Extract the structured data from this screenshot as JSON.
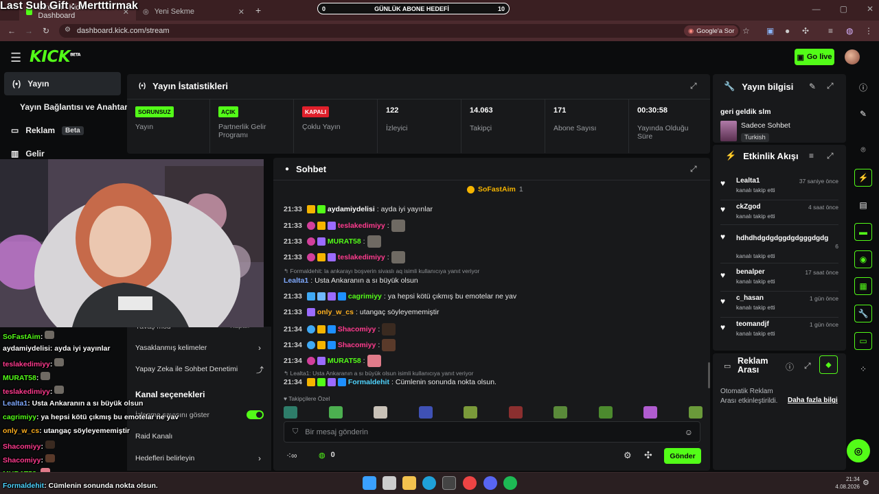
{
  "browser": {
    "tabs": [
      {
        "label": "Stream - Kick Dashboard"
      },
      {
        "label": "Yeni Sekme"
      }
    ],
    "new_tab": "+",
    "url": "dashboard.kick.com/stream",
    "ask_google": "Google'a Sor"
  },
  "overlay": {
    "last_sub": "Last Sub Gift : Mertttirmak",
    "goal_label": "GÜNLÜK ABONE HEDEFİ",
    "goal_current": "0",
    "goal_target": "10"
  },
  "header": {
    "logo": "KICK",
    "logo_tag": "BETA",
    "go_live": "Go live"
  },
  "sidebar": {
    "items": [
      {
        "label": "Yayın"
      },
      {
        "label": "Yayın Bağlantısı ve Anahtarı"
      },
      {
        "label": "Reklam",
        "badge": "Beta"
      },
      {
        "label": "Gelir"
      }
    ]
  },
  "stats": {
    "title": "Yayın İstatistikleri",
    "cells": [
      {
        "badge": "SORUNSUZ",
        "label": "Yayın"
      },
      {
        "badge": "AÇIK",
        "label": "Partnerlik Gelir Programı"
      },
      {
        "badge": "KAPALI",
        "label": "Çoklu Yayın"
      },
      {
        "value": "122",
        "label": "İzleyici"
      },
      {
        "value": "14.063",
        "label": "Takipçi"
      },
      {
        "value": "171",
        "label": "Abone Sayısı"
      },
      {
        "value": "00:30:58",
        "label": "Yayında Olduğu Süre"
      }
    ]
  },
  "info": {
    "title": "Yayın bilgisi",
    "stream_title": "geri geldik slm",
    "category": "Sadece Sohbet",
    "language": "Turkish"
  },
  "events": {
    "title": "Etkinlik Akışı",
    "items": [
      {
        "name": "Lealta1",
        "action": "kanalı takip etti",
        "time": "37 saniye önce"
      },
      {
        "name": "ckZgod",
        "action": "kanalı takip etti",
        "time": "4 saat önce"
      },
      {
        "name": "hdhdhdgdgdggdgdgggdgdg",
        "action": "kanalı takip etti",
        "time": "6"
      },
      {
        "name": "benalper",
        "action": "kanalı takip etti",
        "time": "17 saat önce"
      },
      {
        "name": "c_hasan",
        "action": "kanalı takip etti",
        "time": "1 gün önce"
      },
      {
        "name": "teomandjf",
        "action": "kanalı takip etti",
        "time": "1 gün önce"
      }
    ]
  },
  "ads": {
    "title": "Reklam Arası",
    "text": "Otomatik Reklam Arası etkinleştirildi.",
    "link": "Daha fazla bilgi"
  },
  "chat": {
    "title": "Sohbet",
    "pinned_user": "SoFastAim",
    "pinned_count": "1",
    "messages": [
      {
        "time": "21:33",
        "user": "aydamiydelisi",
        "text": "ayda iyi yayınlar",
        "color": "#ffffff"
      },
      {
        "time": "21:33",
        "user": "teslakedimiyy",
        "text": "",
        "color": "#ff3b8e"
      },
      {
        "time": "21:33",
        "user": "MURAT58",
        "text": "",
        "color": "#53fc18"
      },
      {
        "time": "21:33",
        "user": "teslakedimiyy",
        "text": "",
        "color": "#ff3b8e"
      },
      {
        "reply": "Formaldehit: la ankarayı boşverin sivaslı aq isimli kullanıcıya yanıt veriyor",
        "user": "Lealta1",
        "text": "Usta Ankaranın a sı büyük olsun",
        "color": "#7fa9ff"
      },
      {
        "time": "21:33",
        "user": "cagrimiyy",
        "text": "ya hepsi kötü çıkmış bu emotelar ne yav",
        "color": "#53fc18"
      },
      {
        "time": "21:33",
        "user": "only_w_cs",
        "text": "utangaç söyleyememiştir",
        "color": "#ffb01f"
      },
      {
        "time": "21:34",
        "user": "Shacomiyy",
        "text": "",
        "color": "#ff3b8e"
      },
      {
        "time": "21:34",
        "user": "Shacomiyy",
        "text": "",
        "color": "#ff3b8e"
      },
      {
        "time": "21:34",
        "user": "MURAT58",
        "text": "",
        "color": "#53fc18"
      },
      {
        "reply": "Lealta1: Usta Ankaranın a sı büyük olsun isimli kullanıcıya yanıt veriyor",
        "time": "21:34",
        "user": "Formaldehit",
        "text": "Cümlenin sonunda nokta olsun.",
        "color": "#4fd4ff"
      }
    ],
    "followers_only": "Takipçilere Özel",
    "input_placeholder": "Bir mesaj gönderin",
    "points": "0",
    "send": "Gönder"
  },
  "mod_panel": {
    "partial_top": "Yavaş mod",
    "partial_right": "Kapalı",
    "items": [
      {
        "label": "Yasaklanmış kelimeler"
      },
      {
        "label": "Yapay Zeka ile Sohbet Denetimi"
      }
    ],
    "section": "Kanal seçenekleri",
    "items2": [
      {
        "label": "İzlenme sayısını göster"
      },
      {
        "label": "Raid Kanalı"
      },
      {
        "label": "Hedefleri belirleyin"
      }
    ]
  },
  "overlay_chat": [
    {
      "user": "SoFastAim",
      "text": "",
      "color": "#53fc18"
    },
    {
      "user": "aydamiydelisi",
      "text": "ayda iyi yayınlar",
      "color": "#ffffff"
    },
    {
      "user": "teslakedimiyy",
      "text": "",
      "color": "#ff3b8e"
    },
    {
      "user": "MURAT58",
      "text": "",
      "color": "#53fc18"
    },
    {
      "user": "teslakedimiyy",
      "text": "",
      "color": "#ff3b8e"
    },
    {
      "user": "Lealta1",
      "text": "Usta Ankaranın a sı büyük olsun",
      "color": "#7fa9ff"
    },
    {
      "user": "cagrimiyy",
      "text": "ya hepsi kötü çıkmış bu emotelar ne yav",
      "color": "#53fc18"
    },
    {
      "user": "only_w_cs",
      "text": "utangaç söyleyememiştir",
      "color": "#ffb01f"
    },
    {
      "user": "Shacomiyy",
      "text": "",
      "color": "#ff3b8e"
    },
    {
      "user": "Shacomiyy",
      "text": "",
      "color": "#ff3b8e"
    },
    {
      "user": "MURAT58",
      "text": "",
      "color": "#53fc18"
    },
    {
      "user": "Formaldehit",
      "text": "Cümlenin sonunda nokta olsun.",
      "color": "#4fd4ff"
    }
  ],
  "taskbar": {
    "time": "21:34",
    "date": "4.08.2026"
  },
  "colors": {
    "accent": "#53fc18",
    "panel": "#18191b",
    "bg": "#0b0c0d"
  }
}
